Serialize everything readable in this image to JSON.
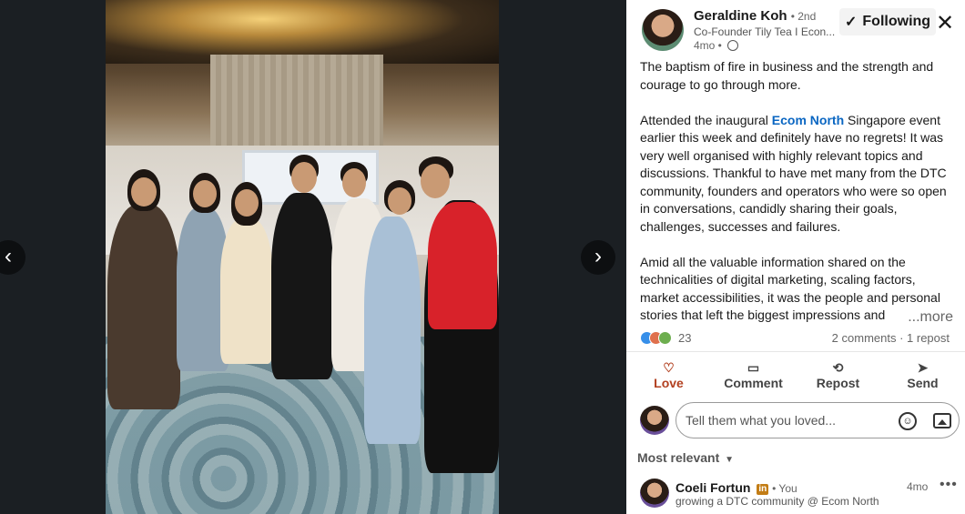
{
  "viewer": {
    "prev_label": "‹",
    "next_label": "›",
    "photo_alt": ""
  },
  "post": {
    "author_name": "Geraldine Koh",
    "degree": "• 2nd",
    "author_headline": "Co-Founder Tily Tea I Econ...",
    "time_ago": "4mo •",
    "follow_label": "Following",
    "follow_check": "✓",
    "close_label": "✕",
    "paragraph_1": "The baptism of fire in business and the strength and courage to go through more.",
    "paragraph_2_before": "Attended the inaugural ",
    "paragraph_2_link": "Ecom North",
    "paragraph_2_after": " Singapore event earlier this week and definitely have no regrets! It was very well organised with highly relevant topics and discussions. Thankful to have met many from the DTC community, founders and operators who were so open in conversations, candidly sharing their goals, challenges, successes and failures.",
    "paragraph_3": "Amid all the valuable information shared on the technicalities of digital marketing, scaling factors, market accessibilities, it was the people and personal stories that left the biggest impressions and",
    "more_label": "...more"
  },
  "social": {
    "reaction_count": "23",
    "comments_reposts": "2 comments · 1 repost"
  },
  "actions": [
    {
      "label": "Love",
      "icon": "♡"
    },
    {
      "label": "Comment",
      "icon": "▭"
    },
    {
      "label": "Repost",
      "icon": "⟲"
    },
    {
      "label": "Send",
      "icon": "➤"
    }
  ],
  "comment_box": {
    "placeholder": "Tell them what you loved...",
    "emoji_icon": "☺"
  },
  "sort": {
    "label": "Most relevant",
    "caret": "▼"
  },
  "comment": {
    "name": "Coeli Fortun",
    "badge": "in",
    "you": "• You",
    "headline": "growing a DTC community @ Ecom North",
    "time": "4mo",
    "more": "•••"
  },
  "colors": {
    "link": "#0a66c2",
    "love": "#b24020",
    "badge": "#c37d16"
  }
}
